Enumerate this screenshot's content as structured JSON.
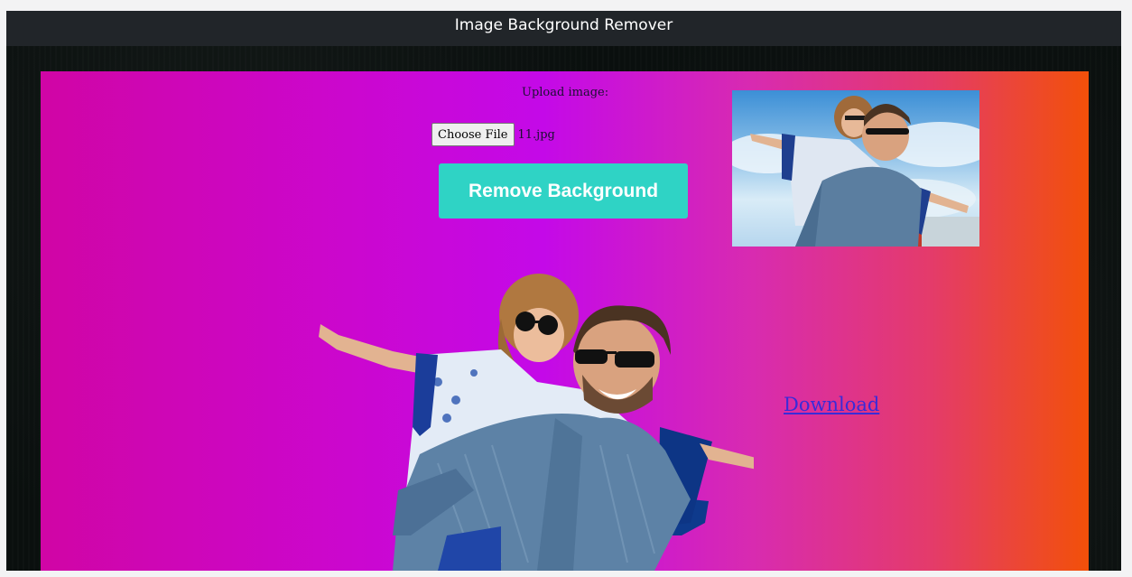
{
  "navbar": {
    "title": "Image Background Remover"
  },
  "form": {
    "upload_label": "Upload image:",
    "choose_file_label": "Choose File",
    "file_name": "11.jpg",
    "remove_button_label": "Remove Background"
  },
  "result": {
    "download_label": "Download"
  },
  "colors": {
    "navbar_bg": "#212529",
    "button_bg": "#2fd3c5",
    "gradient": [
      "#d005a5",
      "#c409e8",
      "#f25009"
    ],
    "link": "#3a2bd8"
  },
  "icons": {
    "original_preview": "photo-couple-sky",
    "result_preview": "photo-couple-cutout"
  }
}
